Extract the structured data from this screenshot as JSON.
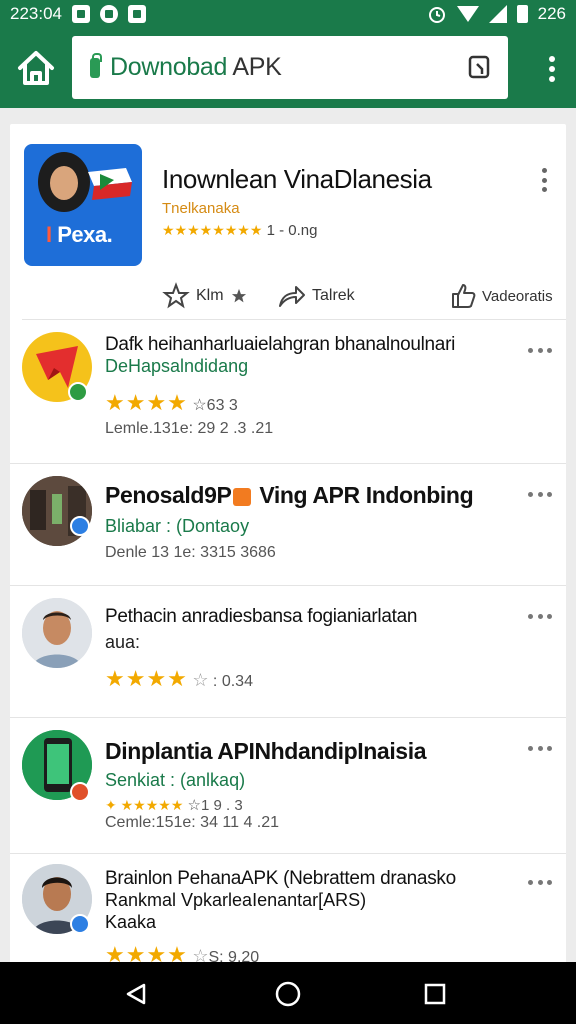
{
  "status_bar": {
    "time": "223:04",
    "right_text": "226",
    "icons": [
      "mail-icon",
      "messenger-icon",
      "camera-icon",
      "alarm-icon",
      "wifi-icon",
      "signal-icon",
      "battery-icon"
    ]
  },
  "app_bar": {
    "url_primary": "Downobad",
    "url_secondary": " APK",
    "icons": [
      "home-icon",
      "lock-icon",
      "tabs-icon",
      "overflow-menu-icon"
    ]
  },
  "featured": {
    "icon_brand_prefix": "I",
    "icon_brand_text": "Pexa.",
    "title": "Inownlean VinaDlanesia",
    "subtitle": "Tnelkanaka",
    "stars": "★★★★★★★★",
    "rating_text": " 1 - 0.ng",
    "actions": {
      "like": "Klm",
      "share": "Talrek",
      "rate": "Vadeoratis"
    }
  },
  "items": [
    {
      "title": "Dafk heihanharluaielahgran bhanalnoulnari",
      "subtitle": "DeHapsalndidang",
      "stars": "★★★★",
      "rating_text": " ☆63 3",
      "meta": "Lemle.131e: 29 2 .3 .21",
      "badge_color": "#2e9c42"
    },
    {
      "title_prefix": "Penosald",
      "title_mid": "9P",
      "title_suffix": " Ving APR  Indonbing",
      "subtitle": "Bliabar : (Dontaoy",
      "meta": "Denle 13 1e: 3315 3686",
      "badge_color": "#2d7fe3"
    },
    {
      "title": "Pethacin anradiesbansa fogianiarlatan",
      "subtitle": "aua:",
      "stars": "★★★★",
      "rating_empty": "☆",
      "rating_text": " : 0.34",
      "badge_color": ""
    },
    {
      "title": "Dinplantia APINhdandipInaisia",
      "subtitle": "Senkiat : (anlkaq)",
      "stars_small": "✦ ★★★★★",
      "rating_text": "  ☆1 9 . 3",
      "meta": "Cemle:151e: 34 11 4 .21",
      "badge_color": "#e0502a"
    },
    {
      "title": "Brainlon PehanaAPK (Nebrattem dranasko",
      "line2": "Rankmal VpkarleaIenantar[ARS)",
      "line3": "Kaaka",
      "stars": "★★★★",
      "rating_empty": "☆",
      "rating_text": "S: 9.20",
      "badge_color": "#2d7fe3"
    }
  ],
  "nav": {
    "icons": [
      "back-icon",
      "home-circle-icon",
      "recents-icon"
    ]
  },
  "colors": {
    "brand_green": "#1a7a4a",
    "link_green": "#1a7a4a",
    "star": "#f2a900"
  }
}
